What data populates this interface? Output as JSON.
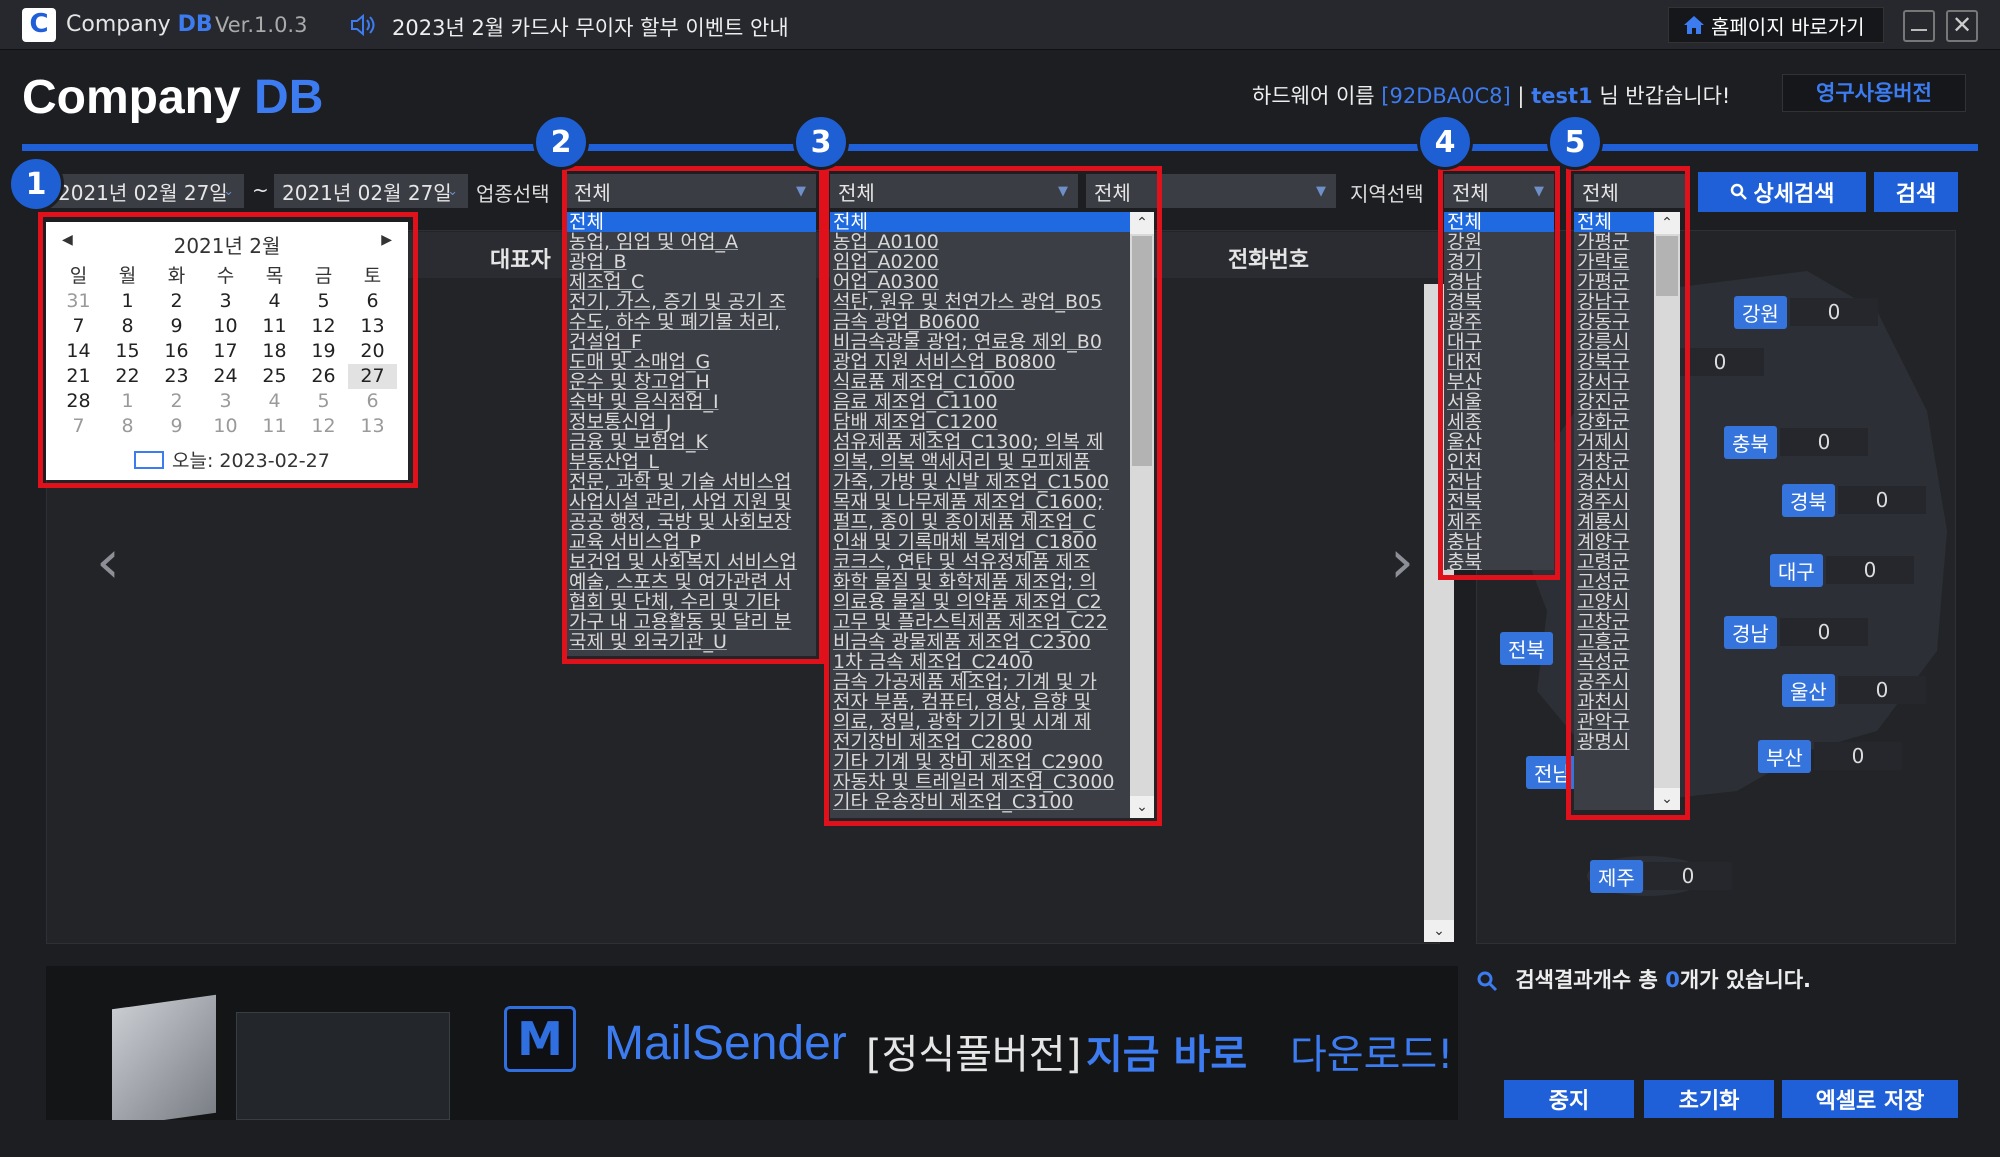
{
  "titlebar": {
    "logo_letter": "C",
    "app_name": "Company",
    "app_name_accent": "DB",
    "version": "Ver.1.0.3",
    "notice": "2023년 2월 카드사 무이자 할부 이벤트 안내",
    "home_button": "홈페이지 바로가기"
  },
  "header": {
    "brand": "Company",
    "brand_accent": "DB",
    "hw_label": "하드웨어 이름",
    "hw_id": "[92DBA0C8]",
    "separator": "|",
    "user": "test1",
    "greeting": "님 반갑습니다!",
    "license": "영구사용버전"
  },
  "markers": [
    "1",
    "2",
    "3",
    "4",
    "5"
  ],
  "search": {
    "date_from": "2021년 02월 27일",
    "tilde": "~",
    "date_to": "2021년 02월 27일",
    "industry_label": "업종선택",
    "industry1": "전체",
    "industry2": "전체",
    "industry3": "전체",
    "industry4": "",
    "region_label": "지역선택",
    "region1": "전체",
    "region2": "전체",
    "detail_button": "상세검색",
    "search_button": "검색"
  },
  "calendar": {
    "title": "2021년 2월",
    "weekdays": [
      "일",
      "월",
      "화",
      "수",
      "목",
      "금",
      "토"
    ],
    "weeks": [
      [
        "31",
        "1",
        "2",
        "3",
        "4",
        "5",
        "6"
      ],
      [
        "7",
        "8",
        "9",
        "10",
        "11",
        "12",
        "13"
      ],
      [
        "14",
        "15",
        "16",
        "17",
        "18",
        "19",
        "20"
      ],
      [
        "21",
        "22",
        "23",
        "24",
        "25",
        "26",
        "27"
      ],
      [
        "28",
        "1",
        "2",
        "3",
        "4",
        "5",
        "6"
      ],
      [
        "7",
        "8",
        "9",
        "10",
        "11",
        "12",
        "13"
      ]
    ],
    "today": "오늘: 2023-02-27"
  },
  "table": {
    "col_rep": "대표자",
    "col_phone": "전화번호"
  },
  "list_industry1": [
    "전체",
    "농업, 임업 및 어업_A",
    "광업_B",
    "제조업_C",
    "전기, 가스, 증기 및 공기 조",
    "수도, 하수 및 폐기물 처리,",
    "건설업_F",
    "도매 및 소매업_G",
    "운수 및 창고업_H",
    "숙박 및 음식점업_I",
    "정보통신업_J",
    "금융 및 보험업_K",
    "부동산업_L",
    "전문, 과학 및 기술 서비스업",
    "사업시설 관리, 사업 지원 및",
    "공공 행정, 국방 및 사회보장",
    "교육 서비스업_P",
    "보건업 및 사회복지 서비스업",
    "예술, 스포츠 및 여가관련 서",
    "협회 및 단체, 수리 및 기타",
    "가구 내 고용활동 및 달리 분",
    "국제 및 외국기관_U"
  ],
  "list_industry2": [
    "전체",
    "농업_A0100",
    "임업_A0200",
    "어업_A0300",
    "석탄, 원유 및 천연가스 광업_B05",
    "금속 광업_B0600",
    "비금속광물 광업; 연료용 제외_B0",
    "광업 지원 서비스업_B0800",
    "식료품 제조업_C1000",
    "음료 제조업_C1100",
    "담배 제조업_C1200",
    "섬유제품 제조업_C1300; 의복 제",
    "의복, 의복 액세서리 및 모피제품",
    "가죽, 가방 및 신발 제조업_C1500",
    "목재 및 나무제품 제조업_C1600;",
    "펄프, 종이 및 종이제품 제조업_C",
    "인쇄 및 기록매체 복제업_C1800",
    "코크스, 연탄 및 석유정제품 제조",
    "화학 물질 및 화학제품 제조업; 의",
    "의료용 물질 및 의약품 제조업_C2",
    "고무 및 플라스틱제품 제조업_C22",
    "비금속 광물제품 제조업_C2300",
    "1차 금속 제조업_C2400",
    "금속 가공제품 제조업; 기계 및 가",
    "전자 부품, 컴퓨터, 영상, 음향 및",
    "의료, 정밀, 광학 기기 및 시계 제",
    "전기장비 제조업_C2800",
    "기타 기계 및 장비 제조업_C2900",
    "자동차 및 트레일러 제조업_C3000",
    "기타 운송장비 제조업_C3100"
  ],
  "list_region1": [
    "전체",
    "강원",
    "경기",
    "경남",
    "경북",
    "광주",
    "대구",
    "대전",
    "부산",
    "서울",
    "세종",
    "울산",
    "인천",
    "전남",
    "전북",
    "제주",
    "충남",
    "충북"
  ],
  "list_region2": [
    "전체",
    "가평군",
    "가락로",
    "가평군",
    "강남구",
    "강동구",
    "강릉시",
    "강북구",
    "강서구",
    "강진군",
    "강화군",
    "거제시",
    "거창군",
    "경산시",
    "경주시",
    "계룡시",
    "계양구",
    "고령군",
    "고성군",
    "고양시",
    "고창군",
    "고흥군",
    "곡성군",
    "공주시",
    "과천시",
    "관악구",
    "광명시"
  ],
  "map": {
    "regions": [
      {
        "name": "강원",
        "value": "0"
      },
      {
        "name": "충북",
        "value": "0"
      },
      {
        "name": "경북",
        "value": "0"
      },
      {
        "name": "대구",
        "value": "0"
      },
      {
        "name": "경남",
        "value": "0"
      },
      {
        "name": "울산",
        "value": "0"
      },
      {
        "name": "부산",
        "value": "0"
      },
      {
        "name": "전북",
        "value": ""
      },
      {
        "name": "전남",
        "value": ""
      },
      {
        "name": "제주",
        "value": "0"
      }
    ],
    "extra_value": "0"
  },
  "result": {
    "prefix": "검색결과개수 총",
    "count": "0",
    "suffix": "개가 있습니다."
  },
  "banner": {
    "logo_letter": "M",
    "product": "MailSender",
    "edition": "[정식풀버전]",
    "highlight": "지금 바로",
    "action": "다운로드!"
  },
  "actions": {
    "stop": "중지",
    "reset": "초기화",
    "excel": "엑셀로 저장"
  },
  "colors": {
    "accent": "#1f5fd8",
    "highlight_red": "#e0111b",
    "bg": "#1c1e22"
  }
}
